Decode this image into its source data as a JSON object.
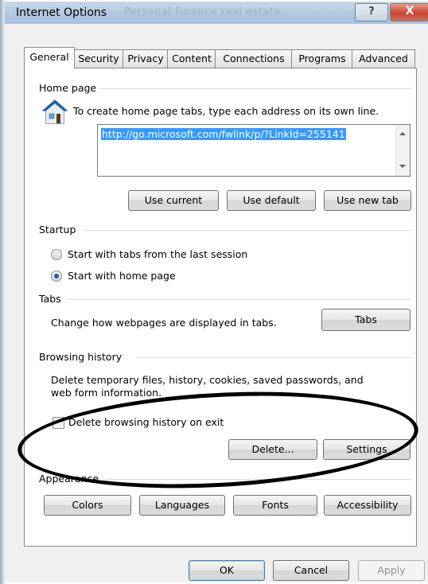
{
  "window": {
    "title": "Internet Options",
    "title_ghost": "Personal Finance  real estate",
    "help_label": "?",
    "close_label": "X"
  },
  "tabs": [
    "General",
    "Security",
    "Privacy",
    "Content",
    "Connections",
    "Programs",
    "Advanced"
  ],
  "home_page": {
    "group_label": "Home page",
    "instruction": "To create home page tabs, type each address on its own line.",
    "url": "http://go.microsoft.com/fwlink/p/?LinkId=255141",
    "use_current": "Use current",
    "use_default": "Use default",
    "use_new_tab": "Use new tab"
  },
  "startup": {
    "group_label": "Startup",
    "option_last_session": "Start with tabs from the last session",
    "option_home_page": "Start with home page",
    "selected": "home_page"
  },
  "tabs_section": {
    "group_label": "Tabs",
    "description": "Change how webpages are displayed in tabs.",
    "button": "Tabs"
  },
  "browsing_history": {
    "group_label": "Browsing history",
    "description_line1": "Delete temporary files, history, cookies, saved passwords, and",
    "description_line2": "web form information.",
    "delete_on_exit": "Delete browsing history on exit",
    "delete_on_exit_checked": false,
    "delete_button": "Delete...",
    "settings_button": "Settings"
  },
  "appearance": {
    "group_label": "Appearance",
    "colors": "Colors",
    "languages": "Languages",
    "fonts": "Fonts",
    "accessibility": "Accessibility"
  },
  "footer": {
    "ok": "OK",
    "cancel": "Cancel",
    "apply": "Apply"
  },
  "colors": {
    "selection": "#3399ff",
    "close_button": "#c8452f",
    "house_roof": "#2a6fc9"
  }
}
